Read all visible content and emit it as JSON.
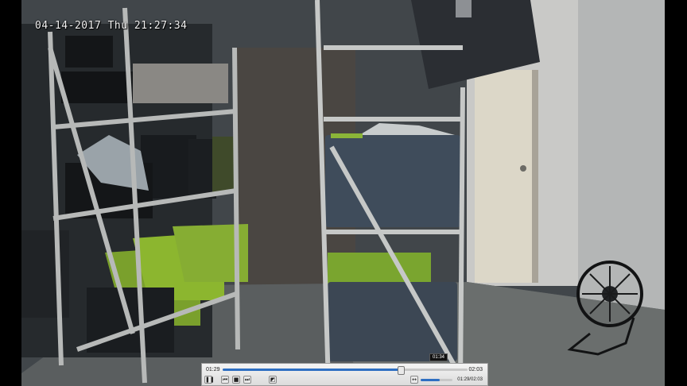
{
  "osd": {
    "timestamp": "04-14-2017 Thu 21:27:34"
  },
  "player": {
    "current_time": "01:29",
    "total_time": "02:03",
    "hover_time": "01:34",
    "position_readout": "01:29/02:03",
    "progress_fraction": 0.724,
    "volume_fraction": 0.6,
    "icons": {
      "play_pause": "pause-icon",
      "prev": "skip-back-icon",
      "stop": "stop-icon",
      "next": "skip-forward-icon",
      "snapshot": "snapshot-icon",
      "fullscreen": "fullscreen-icon",
      "volume": "volume-icon"
    }
  },
  "colors": {
    "accent": "#2e6fc2"
  }
}
